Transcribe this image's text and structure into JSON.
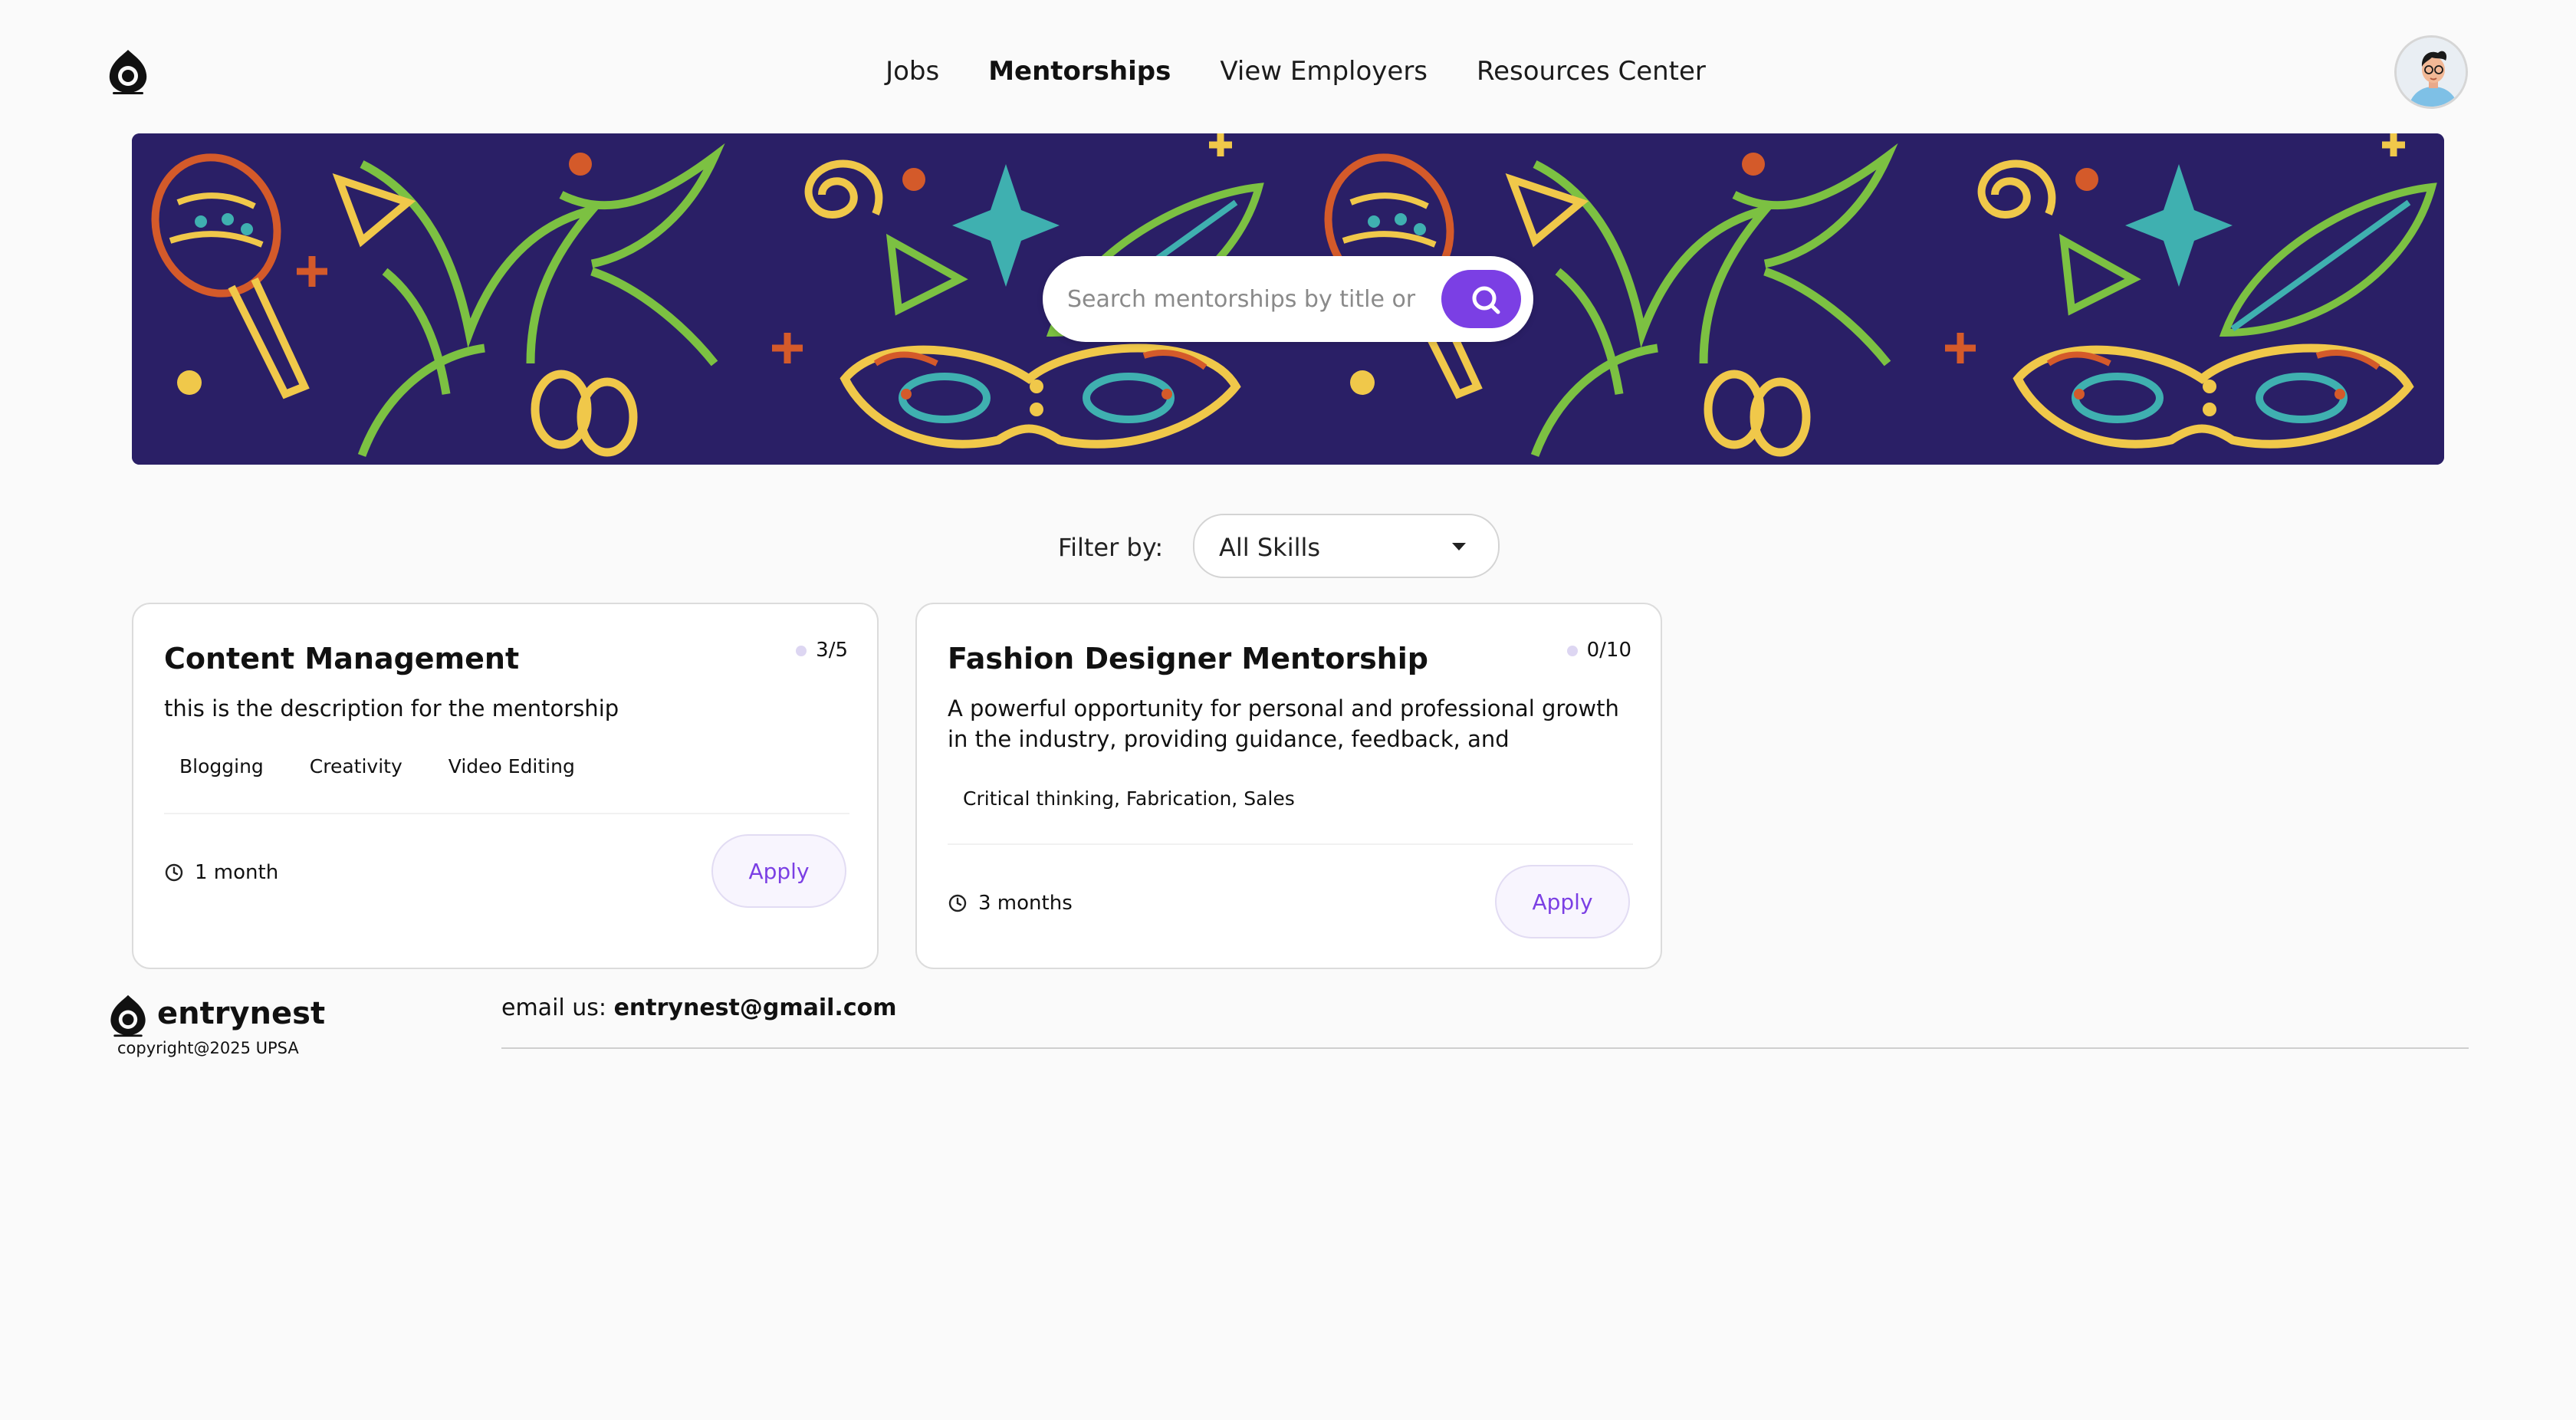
{
  "nav": {
    "items": [
      {
        "label": "Jobs",
        "active": false
      },
      {
        "label": "Mentorships",
        "active": true
      },
      {
        "label": "View Employers",
        "active": false
      },
      {
        "label": "Resources Center",
        "active": false
      }
    ]
  },
  "search": {
    "placeholder": "Search mentorships by title or description",
    "icon": "search-icon"
  },
  "filter": {
    "label": "Filter by:",
    "selected": "All Skills"
  },
  "mentorships": [
    {
      "title": "Content Management",
      "count": "3/5",
      "description": "this is the description for the mentorship",
      "tags": [
        "Blogging",
        "Creativity",
        "Video Editing"
      ],
      "duration": "1 month",
      "apply_label": "Apply"
    },
    {
      "title": "Fashion Designer Mentorship",
      "count": "0/10",
      "description": "A powerful opportunity for personal and professional growth in the industry, providing guidance, feedback, and networkin...",
      "tags": [
        "Critical thinking, Fabrication, Sales"
      ],
      "duration": "3 months",
      "apply_label": "Apply"
    }
  ],
  "footer": {
    "brand": "entrynest",
    "copyright": "copyright@2025 UPSA",
    "email_prefix": "email us:",
    "email": "entrynest@gmail.com"
  },
  "colors": {
    "accent": "#7b3fe4",
    "banner_bg": "#2a1f66",
    "page_bg": "#fafafa"
  }
}
